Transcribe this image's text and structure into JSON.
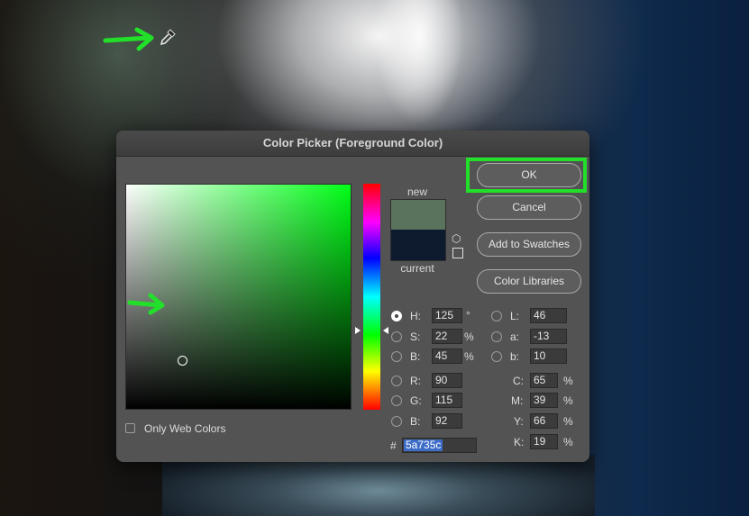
{
  "dialog": {
    "title": "Color Picker (Foreground Color)",
    "new_label": "new",
    "current_label": "current",
    "new_color": "#5a735c",
    "current_color": "#0e1a2e",
    "buttons": {
      "ok": "OK",
      "cancel": "Cancel",
      "add_swatches": "Add to Swatches",
      "color_libraries": "Color Libraries"
    },
    "hsb": {
      "h_label": "H:",
      "h_value": "125",
      "h_unit": "°",
      "s_label": "S:",
      "s_value": "22",
      "s_unit": "%",
      "b_label": "B:",
      "b_value": "45",
      "b_unit": "%"
    },
    "rgb": {
      "r_label": "R:",
      "r_value": "90",
      "g_label": "G:",
      "g_value": "115",
      "b_label": "B:",
      "b_value": "92"
    },
    "lab": {
      "l_label": "L:",
      "l_value": "46",
      "a_label": "a:",
      "a_value": "-13",
      "b_label": "b:",
      "b_value": "10"
    },
    "cmyk": {
      "c_label": "C:",
      "c_value": "65",
      "m_label": "M:",
      "m_value": "39",
      "y_label": "Y:",
      "y_value": "66",
      "k_label": "K:",
      "k_value": "19",
      "unit": "%"
    },
    "hex_prefix": "#",
    "hex_value": "5a735c",
    "only_web_colors": "Only Web Colors",
    "selected_mode": "H"
  },
  "annotation_color": "#22e02a",
  "icons": [
    "eyedropper-icon",
    "arrow-right-icon",
    "cube-icon"
  ]
}
